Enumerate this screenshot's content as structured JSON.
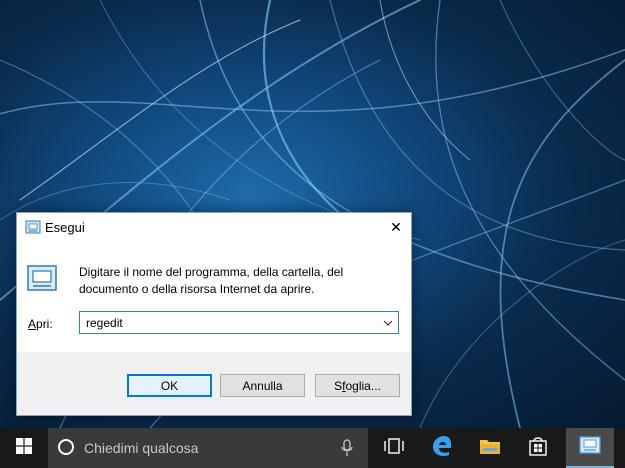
{
  "dialog": {
    "title": "Esegui",
    "close_glyph": "✕",
    "description": "Digitare il nome del programma, della cartella, del documento o della risorsa Internet da aprire.",
    "open_label_accel": "A",
    "open_label_rest": "pri:",
    "combo_value": "regedit",
    "ok_label": "OK",
    "cancel_label": "Annulla",
    "browse_label_pre": "S",
    "browse_label_accel": "f",
    "browse_label_post": "oglia..."
  },
  "taskbar": {
    "search_placeholder": "Chiedimi qualcosa",
    "icons": [
      "windows-start-icon",
      "cortana-icon",
      "microphone-icon",
      "task-view-icon",
      "edge-icon",
      "file-explorer-icon",
      "store-icon",
      "run-app-icon"
    ]
  },
  "colors": {
    "accent": "#0078d7",
    "taskbar": "#1a1a1a",
    "search_box": "#3a3a3a"
  }
}
